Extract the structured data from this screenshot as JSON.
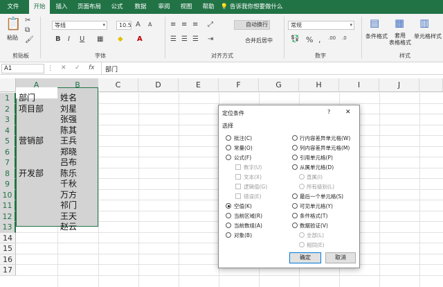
{
  "tabs": [
    "文件",
    "开始",
    "插入",
    "页面布局",
    "公式",
    "数据",
    "审阅",
    "视图",
    "帮助"
  ],
  "tell_me": "告诉我你想要做什么",
  "ribbon": {
    "clipboard": {
      "paste": "粘贴",
      "label": "剪贴板"
    },
    "font": {
      "name": "等线",
      "size": "10.5",
      "grow": "A",
      "shrink": "A",
      "bold": "B",
      "italic": "I",
      "underline": "U",
      "label": "字体"
    },
    "alignment": {
      "wrap": "自动换行",
      "merge": "合并后居中",
      "label": "对齐方式"
    },
    "number": {
      "format": "常规",
      "label": "数字"
    },
    "styles": {
      "conditional": "条件格式",
      "table": "套用\n表格格式",
      "cell": "单元格样式",
      "label": "样式"
    }
  },
  "formula_bar": {
    "name_box": "A1",
    "fx": "fx",
    "value": "部门"
  },
  "columns": [
    "A",
    "B",
    "C",
    "D",
    "E",
    "F",
    "G",
    "H",
    "I",
    "J"
  ],
  "rows": [
    "1",
    "2",
    "3",
    "4",
    "5",
    "6",
    "7",
    "8",
    "9",
    "10",
    "11",
    "12",
    "13",
    "14",
    "15",
    "16",
    "17"
  ],
  "cells": {
    "A": [
      "部门",
      "项目部",
      "",
      "",
      "营销部",
      "",
      "",
      "开发部",
      "",
      "",
      "",
      "",
      ""
    ],
    "B": [
      "姓名",
      "刘星",
      "张强",
      "陈其",
      "王兵",
      "郑晓",
      "吕布",
      "陈乐",
      "千秋",
      "万方",
      "祁门",
      "王天",
      "赵云"
    ]
  },
  "dialog": {
    "title": "定位条件",
    "help": "?",
    "close": "✕",
    "section": "选择",
    "left_options": [
      "批注(C)",
      "常量(O)",
      "公式(F)",
      "数字(U)",
      "文本(X)",
      "逻辑值(G)",
      "错误(E)",
      "空值(K)",
      "当前区域(R)",
      "当前数组(A)",
      "对象(B)"
    ],
    "right_options": [
      "行内容差异单元格(W)",
      "列内容差异单元格(M)",
      "引用单元格(P)",
      "从属单元格(D)",
      "直属(I)",
      "所有级别(L)",
      "最后一个单元格(S)",
      "可见单元格(Y)",
      "条件格式(T)",
      "数据验证(V)",
      "全部(L)",
      "相同(E)"
    ],
    "selected": "空值(K)",
    "ok": "确定",
    "cancel": "取消"
  },
  "colors": {
    "excel_green": "#217346",
    "selection_fill": "#d3d3d3"
  }
}
